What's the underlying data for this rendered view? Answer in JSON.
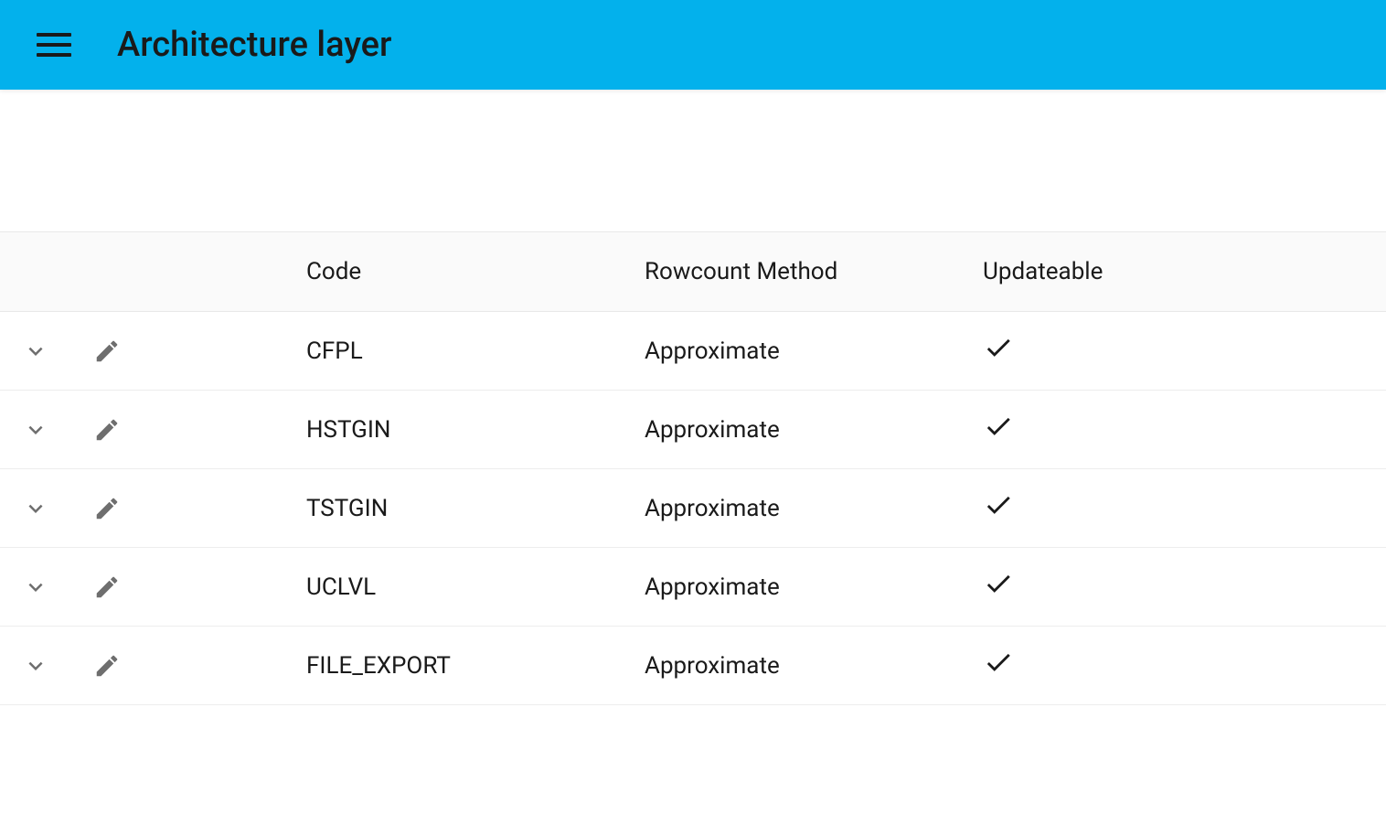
{
  "header": {
    "title": "Architecture layer"
  },
  "table": {
    "columns": {
      "code": "Code",
      "method": "Rowcount Method",
      "updateable": "Updateable"
    },
    "rows": [
      {
        "code": "CFPL",
        "method": "Approximate",
        "updateable": true
      },
      {
        "code": "HSTGIN",
        "method": "Approximate",
        "updateable": true
      },
      {
        "code": "TSTGIN",
        "method": "Approximate",
        "updateable": true
      },
      {
        "code": "UCLVL",
        "method": "Approximate",
        "updateable": true
      },
      {
        "code": "FILE_EXPORT",
        "method": "Approximate",
        "updateable": true
      }
    ]
  }
}
